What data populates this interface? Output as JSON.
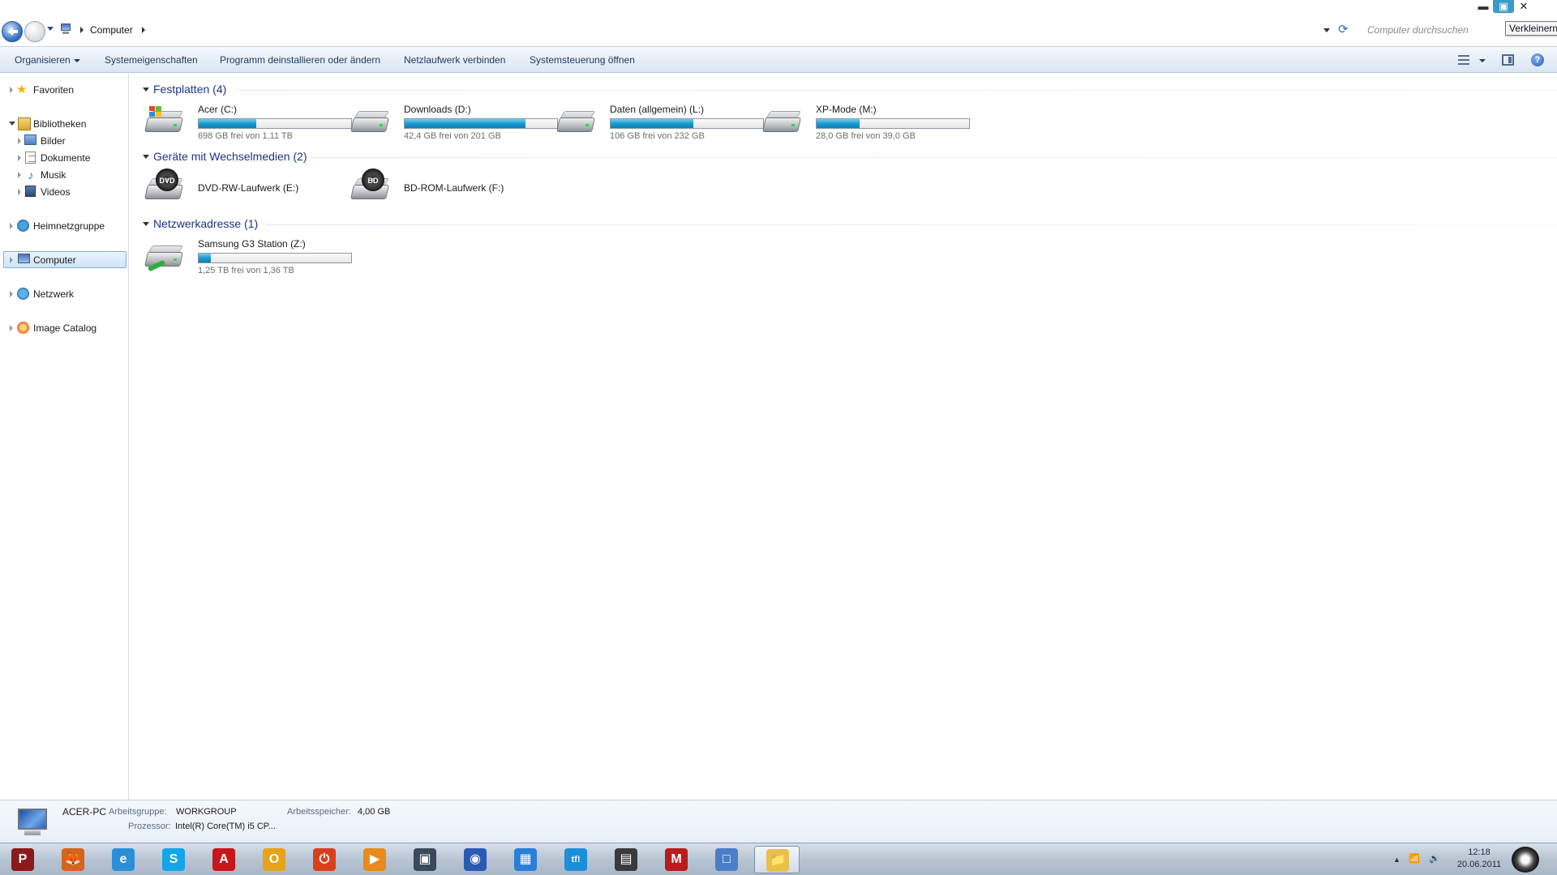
{
  "window": {
    "breadcrumb": "Computer",
    "search_placeholder": "Computer durchsuchen",
    "tooltip": "Verkleinern",
    "controls": {
      "min": "▬",
      "max": "▣",
      "close": "✕"
    }
  },
  "toolbar": {
    "organize": "Organisieren",
    "system_properties": "Systemeigenschaften",
    "uninstall": "Programm deinstallieren oder ändern",
    "map_drive": "Netzlaufwerk verbinden",
    "control_panel": "Systemsteuerung öffnen",
    "help": "?"
  },
  "sidebar": {
    "items": [
      {
        "label": "Favoriten",
        "icon": "star-icon"
      },
      {
        "label": "Bibliotheken",
        "icon": "libraries-icon"
      },
      {
        "label": "Bilder",
        "icon": "pictures-icon"
      },
      {
        "label": "Dokumente",
        "icon": "documents-icon"
      },
      {
        "label": "Musik",
        "icon": "music-icon"
      },
      {
        "label": "Videos",
        "icon": "videos-icon"
      },
      {
        "label": "Heimnetzgruppe",
        "icon": "homegroup-icon"
      },
      {
        "label": "Computer",
        "icon": "computer-icon",
        "selected": true
      },
      {
        "label": "Netzwerk",
        "icon": "network-icon"
      },
      {
        "label": "Image Catalog",
        "icon": "image-catalog-icon"
      }
    ]
  },
  "groups": {
    "hdd": {
      "title": "Festplatten (4)",
      "drives": [
        {
          "name": "Acer (C:)",
          "free": "698 GB frei von 1,11 TB",
          "used_fraction": 0.38
        },
        {
          "name": "Downloads (D:)",
          "free": "42,4 GB frei von 201 GB",
          "used_fraction": 0.79
        },
        {
          "name": "Daten (allgemein) (L:)",
          "free": "106 GB frei von 232 GB",
          "used_fraction": 0.54
        },
        {
          "name": "XP-Mode (M:)",
          "free": "28,0 GB frei von 39,0 GB",
          "used_fraction": 0.28
        }
      ]
    },
    "removable": {
      "title": "Geräte mit Wechselmedien (2)",
      "drives": [
        {
          "name": "DVD-RW-Laufwerk (E:)",
          "badge": "DVD"
        },
        {
          "name": "BD-ROM-Laufwerk (F:)",
          "badge": "BD"
        }
      ]
    },
    "network": {
      "title": "Netzwerkadresse (1)",
      "drives": [
        {
          "name": "Samsung G3 Station (Z:)",
          "free": "1,25 TB frei von 1,36 TB",
          "used_fraction": 0.08
        }
      ]
    }
  },
  "details": {
    "pc_name": "ACER-PC",
    "workgroup_label": "Arbeitsgruppe:",
    "workgroup": "WORKGROUP",
    "memory_label": "Arbeitsspeicher:",
    "memory": "4,00 GB",
    "cpu_label": "Prozessor:",
    "cpu": "Intel(R) Core(TM) i5 CP..."
  },
  "taskbar": {
    "apps": [
      {
        "name": "porsche-app",
        "glyph": "P",
        "color": "#8b1a1a"
      },
      {
        "name": "firefox-app",
        "glyph": "🦊",
        "color": "#d9621c"
      },
      {
        "name": "internet-explorer-app",
        "glyph": "e",
        "color": "#2a8fd8"
      },
      {
        "name": "skype-app",
        "glyph": "S",
        "color": "#12a5e8"
      },
      {
        "name": "avira-app",
        "glyph": "A",
        "color": "#c8161d"
      },
      {
        "name": "outlook-app",
        "glyph": "O",
        "color": "#e8a21c"
      },
      {
        "name": "power-app",
        "glyph": "⏻",
        "color": "#d8401c"
      },
      {
        "name": "media-player-app",
        "glyph": "▶",
        "color": "#e88a1c"
      },
      {
        "name": "monitor-app",
        "glyph": "▣",
        "color": "#3a4a5c"
      },
      {
        "name": "network-app",
        "glyph": "◉",
        "color": "#2a5ab3"
      },
      {
        "name": "windows-app",
        "glyph": "▦",
        "color": "#2a7fd8"
      },
      {
        "name": "tf-app",
        "glyph": "tf!",
        "color": "#1c8fd8"
      },
      {
        "name": "film-app",
        "glyph": "▤",
        "color": "#3a3a3a"
      },
      {
        "name": "malwarebytes-app",
        "glyph": "M",
        "color": "#b81c1c"
      },
      {
        "name": "window-app",
        "glyph": "□",
        "color": "#4a7fc8"
      },
      {
        "name": "explorer-app",
        "glyph": "📁",
        "color": "#e8c14a",
        "active": true
      }
    ],
    "time": "12:18",
    "date": "20.06.2011",
    "tray": {
      "up": "▲",
      "signal": "📶",
      "volume": "🔊"
    }
  }
}
